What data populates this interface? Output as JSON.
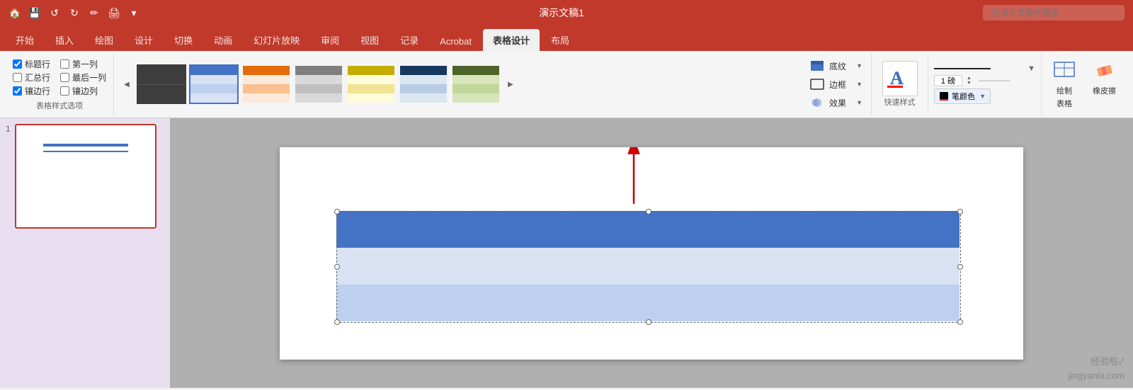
{
  "titleBar": {
    "title": "演示文稿1",
    "searchPlaceholder": "在演示文稿中搜索",
    "icons": [
      "home",
      "save",
      "undo",
      "redo",
      "edit",
      "print",
      "more"
    ]
  },
  "ribbonTabs": {
    "tabs": [
      {
        "label": "开始",
        "active": false
      },
      {
        "label": "插入",
        "active": false
      },
      {
        "label": "绘图",
        "active": false
      },
      {
        "label": "设计",
        "active": false
      },
      {
        "label": "切换",
        "active": false
      },
      {
        "label": "动画",
        "active": false
      },
      {
        "label": "幻灯片放映",
        "active": false
      },
      {
        "label": "审阅",
        "active": false
      },
      {
        "label": "视图",
        "active": false
      },
      {
        "label": "记录",
        "active": false
      },
      {
        "label": "Acrobat",
        "active": false
      },
      {
        "label": "表格设计",
        "active": true
      },
      {
        "label": "布局",
        "active": false
      }
    ]
  },
  "ribbon": {
    "tableOptions": {
      "label": "表格样式选项",
      "checkboxes": [
        {
          "label": "标题行",
          "checked": true
        },
        {
          "label": "第一列",
          "checked": false
        },
        {
          "label": "汇总行",
          "checked": false
        },
        {
          "label": "最后一列",
          "checked": false
        },
        {
          "label": "镶边行",
          "checked": true
        },
        {
          "label": "镶边列",
          "checked": false
        }
      ]
    },
    "stylesPrev": "◀",
    "stylesNext": "▶",
    "effects": {
      "label": "底纹",
      "border": "边框",
      "effect": "效果"
    },
    "quickStyle": {
      "label": "快速样式",
      "icon": "A"
    },
    "pen": {
      "lineWeight": "1 磅",
      "penColor": "笔颜色",
      "lineStyle": "—————"
    },
    "draw": {
      "drawTable": "绘制\n表格",
      "eraser": "橡皮擦"
    }
  },
  "slidePanel": {
    "slideNumber": "1"
  },
  "watermark": {
    "line1": "经验啦✓",
    "line2": "jingyanla.com"
  },
  "arrow": {
    "color": "#cc0000"
  }
}
